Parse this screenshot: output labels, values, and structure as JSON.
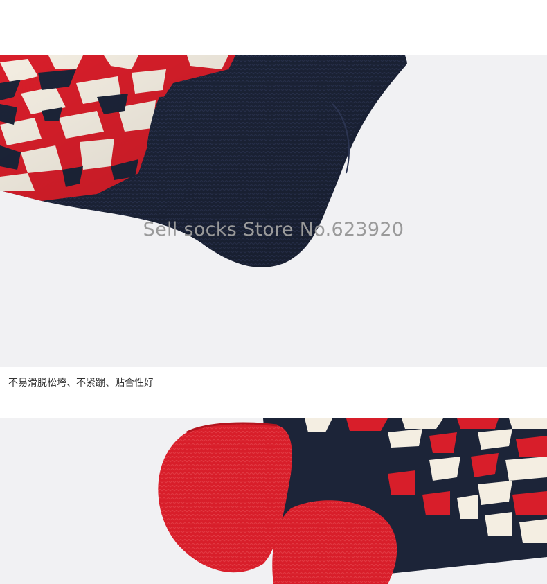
{
  "page": {
    "top_fragment": "",
    "watermark": "Sell socks  Store No.623920",
    "caption": "不易滑脱松垮、不紧蹦、贴合性好"
  },
  "colors": {
    "navy": "#1c2438",
    "red": "#d81e2a",
    "cream": "#f4eee2",
    "background": "#f1f1f3"
  },
  "images": {
    "photo1": "Close-up of navy sock cuffs with red and cream diamond pattern",
    "photo2": "Close-up of red sock toes with navy, red and cream diamond pattern"
  }
}
